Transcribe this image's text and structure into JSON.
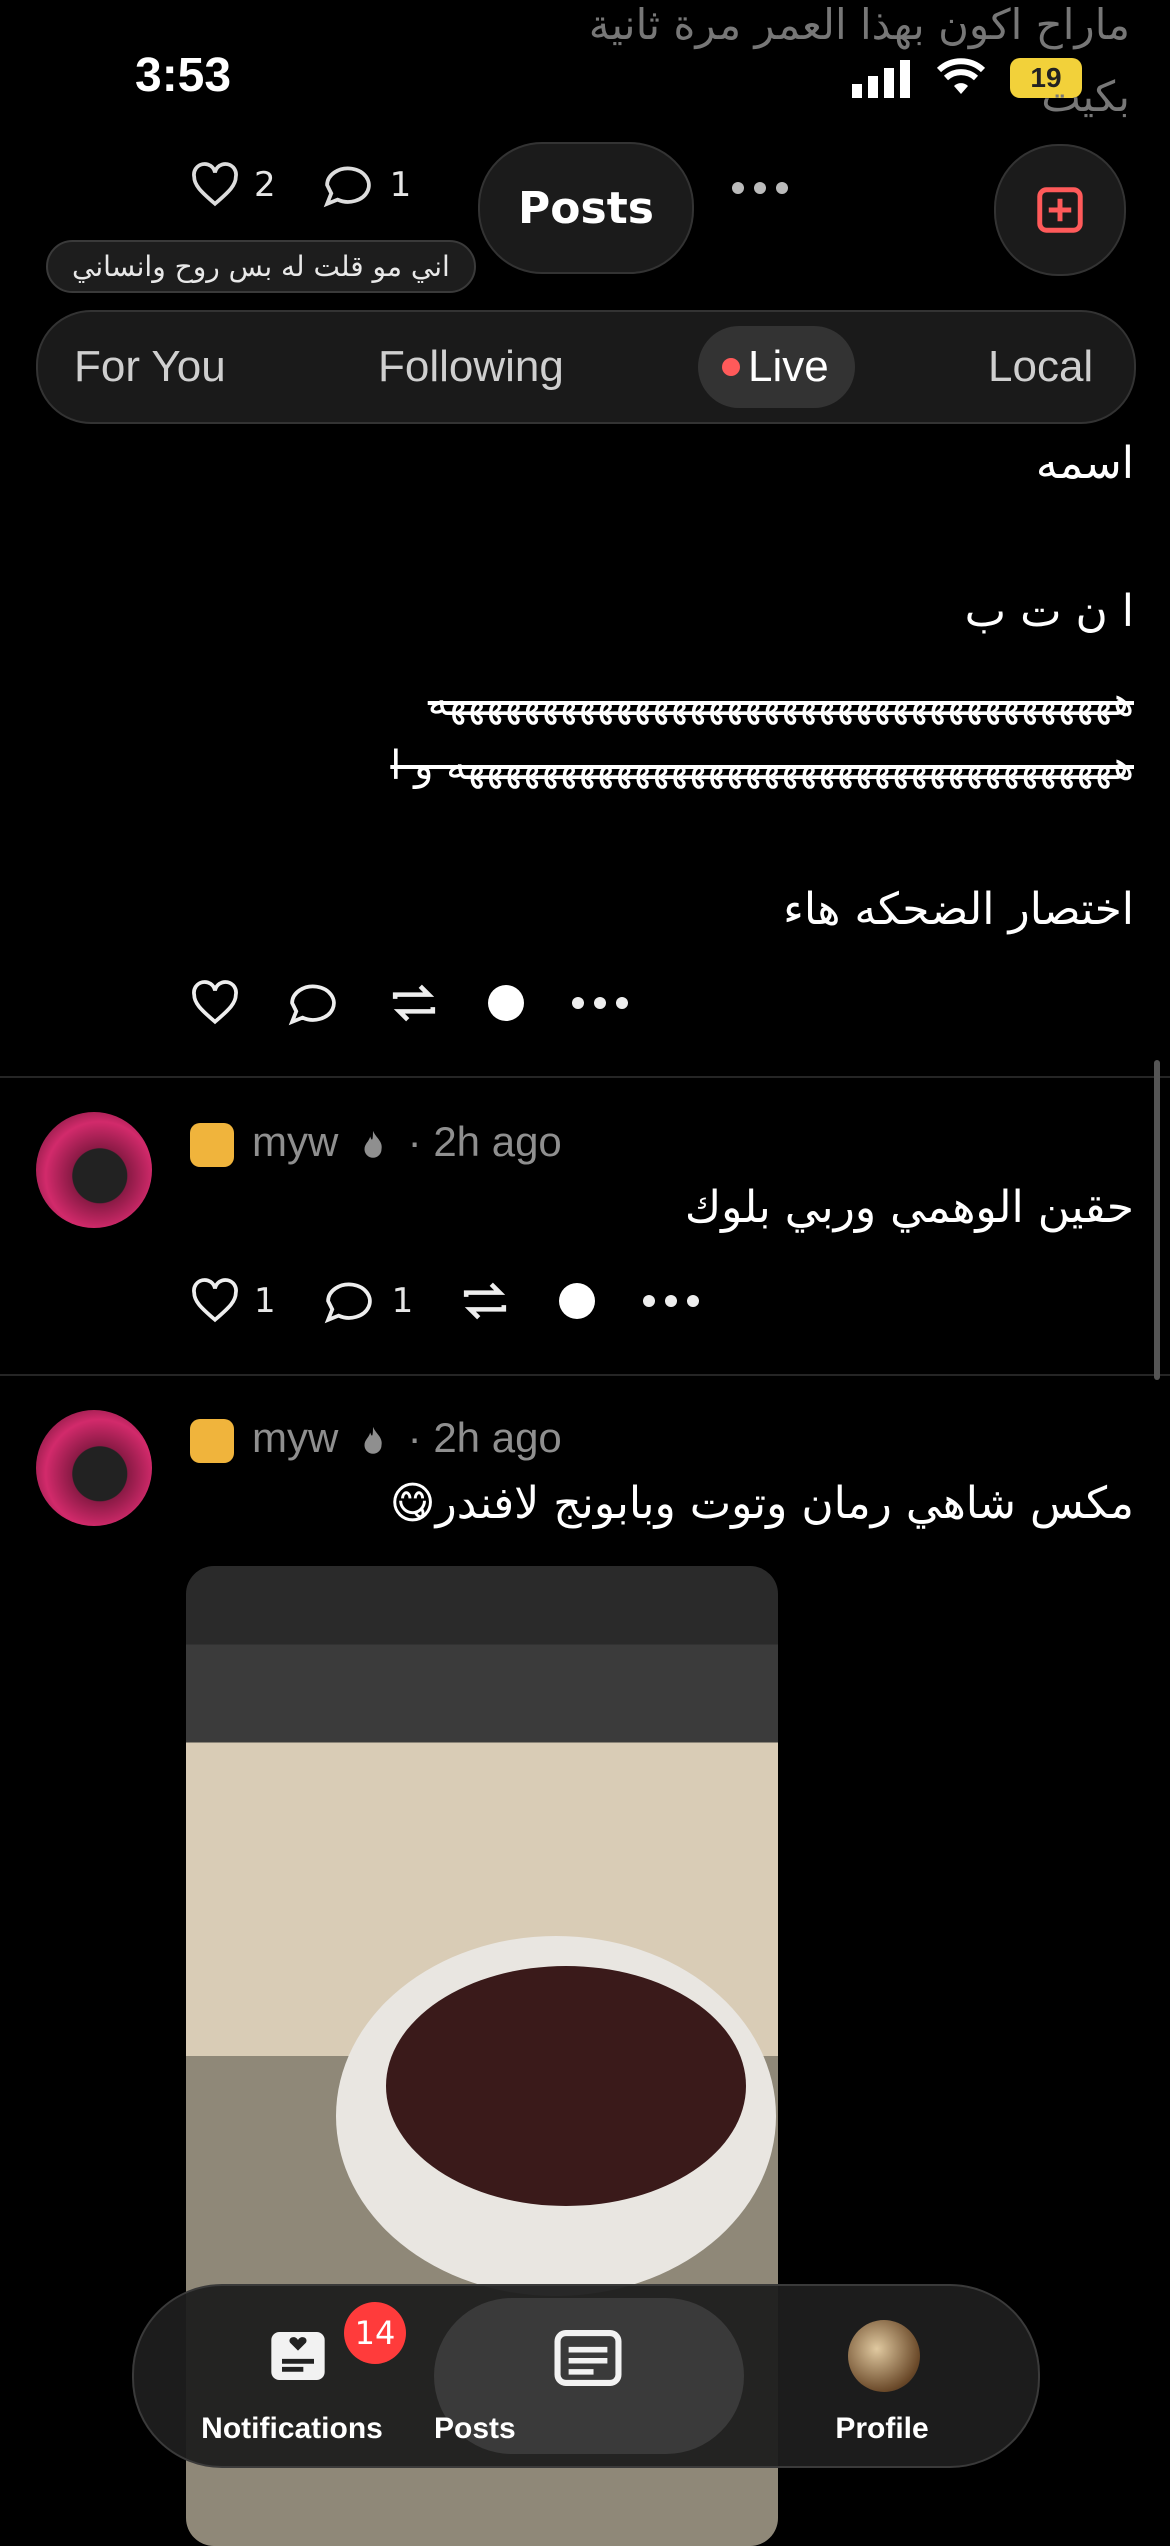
{
  "status_bar": {
    "time": "3:53",
    "battery": "19"
  },
  "header": {
    "title": "Posts"
  },
  "tooltip": "اني مو قلت له بس روح وانساني",
  "tabs": {
    "for_you": "For You",
    "following": "Following",
    "live": "Live",
    "local": "Local"
  },
  "prev_post": {
    "partial_text_1": "ماراح اكون بهذا العمر مرة ثانية",
    "partial_text_2": "بكيت",
    "likes": "2",
    "comments": "1"
  },
  "post1": {
    "line1": "اسمه",
    "line2": "ا ن ت ب",
    "line3": "هههههههههههههههههههههههههههههههههههههه",
    "line4": "ههههههههههههههههههههههههههههههههههههه و ا",
    "line5": "اختصار الضحكه هاء"
  },
  "post2": {
    "username": "myw",
    "time": "· 2h ago",
    "text": "حقين الوهمي وربي بلوك",
    "likes": "1",
    "comments": "1"
  },
  "post3": {
    "username": "myw",
    "time": "· 2h ago",
    "text": "مكس شاهي رمان وتوت وبابونج لافندر😋"
  },
  "bottom_nav": {
    "notifications": "Notifications",
    "notifications_badge": "14",
    "posts": "Posts",
    "profile": "Profile"
  },
  "colors": {
    "accent": "#ff5a5a",
    "background": "#000000",
    "badge": "#ff3b3b"
  }
}
